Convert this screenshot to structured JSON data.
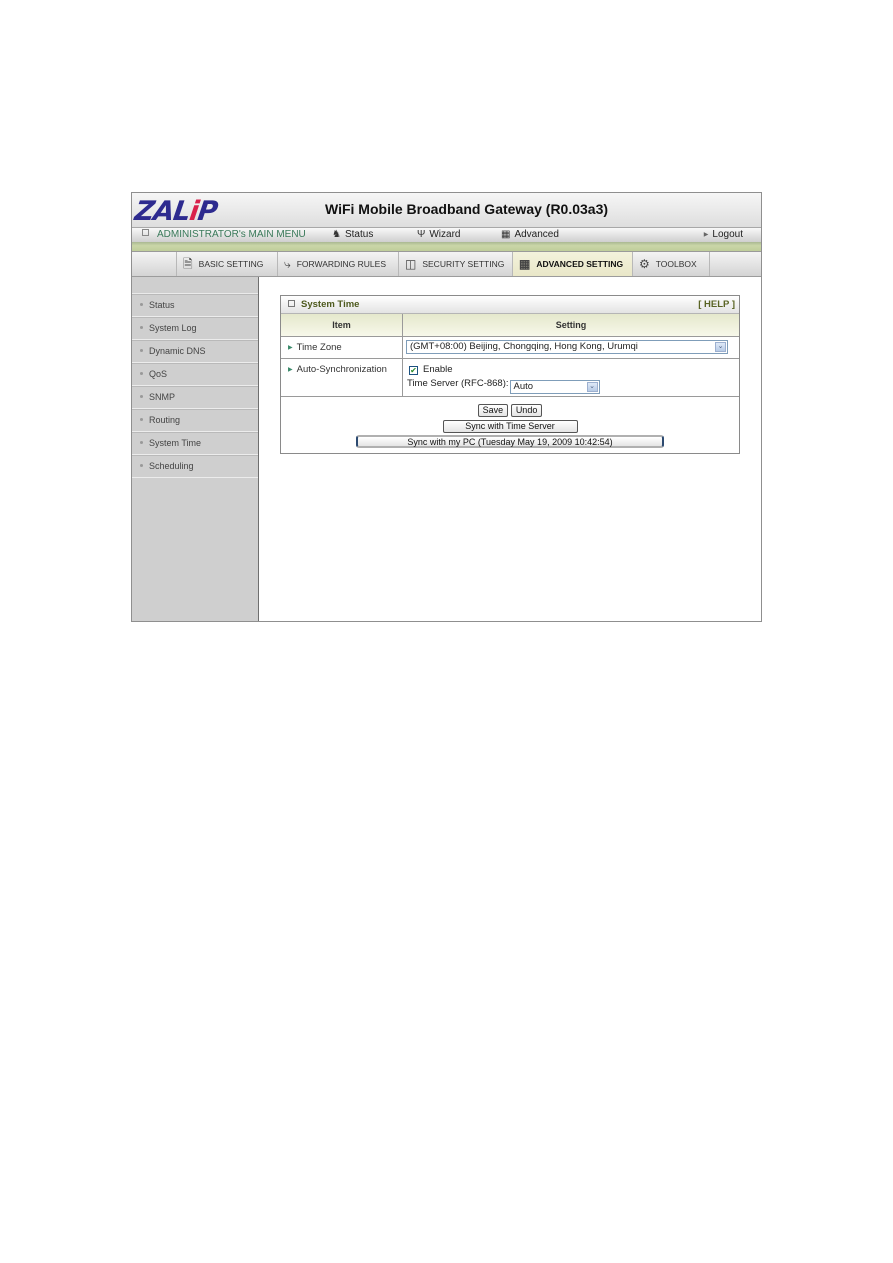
{
  "header": {
    "logo": "ZALIP",
    "title": "WiFi Mobile Broadband Gateway (R0.03a3)"
  },
  "main_menu": {
    "admin_label": "ADMINISTRATOR's MAIN MENU",
    "items": [
      {
        "label": "Status",
        "icon": "status-person-icon"
      },
      {
        "label": "Wizard",
        "icon": "wizard-icon"
      },
      {
        "label": "Advanced",
        "icon": "advanced-icon"
      }
    ],
    "logout": "Logout"
  },
  "tabs": [
    {
      "label": "BASIC SETTING",
      "icon": "basic-setting-icon",
      "active": false
    },
    {
      "label": "FORWARDING RULES",
      "icon": "forwarding-rules-icon",
      "active": false
    },
    {
      "label": "SECURITY SETTING",
      "icon": "security-setting-icon",
      "active": false
    },
    {
      "label": "ADVANCED SETTING",
      "icon": "advanced-setting-icon",
      "active": true
    },
    {
      "label": "TOOLBOX",
      "icon": "toolbox-icon",
      "active": false
    }
  ],
  "sidebar": {
    "items": [
      {
        "label": "Status"
      },
      {
        "label": "System Log"
      },
      {
        "label": "Dynamic DNS"
      },
      {
        "label": "QoS"
      },
      {
        "label": "SNMP"
      },
      {
        "label": "Routing"
      },
      {
        "label": "System Time"
      },
      {
        "label": "Scheduling"
      }
    ]
  },
  "panel": {
    "title": "System Time",
    "help": "[ HELP ]",
    "col_item": "Item",
    "col_setting": "Setting",
    "time_zone": {
      "label": "Time Zone",
      "value": "(GMT+08:00) Beijing, Chongqing, Hong Kong, Urumqi"
    },
    "auto_sync": {
      "label": "Auto-Synchronization",
      "enable_label": "Enable",
      "enable_checked": true,
      "server_label": "Time Server (RFC-868):",
      "server_value": "Auto"
    },
    "buttons": {
      "save": "Save",
      "undo": "Undo",
      "sync_server": "Sync with Time Server",
      "sync_pc": "Sync with my PC (Tuesday May 19, 2009 10:42:54)"
    }
  },
  "colors": {
    "logo": "#2d2a8f",
    "logo_dot": "#d9214b",
    "admin_menu_text": "#3a7a5a",
    "green_bar": "#cad6a8",
    "sidebar_bg": "#cfcfcf",
    "active_tab": "#f3f2dc"
  }
}
